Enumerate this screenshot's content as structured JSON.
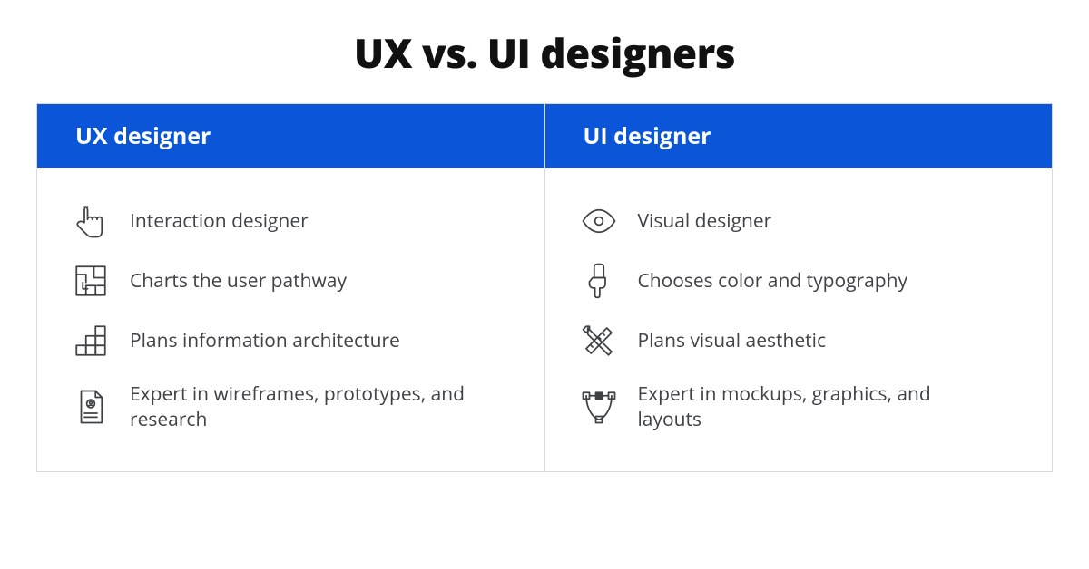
{
  "title": "UX vs. UI designers",
  "columns": {
    "left": {
      "header": "UX designer",
      "items": [
        {
          "label": "Interaction designer",
          "icon": "pointer-icon"
        },
        {
          "label": "Charts the user pathway",
          "icon": "maze-icon"
        },
        {
          "label": "Plans information architecture",
          "icon": "blocks-icon"
        },
        {
          "label": "Expert in wireframes, prototypes, and research",
          "icon": "document-icon"
        }
      ]
    },
    "right": {
      "header": "UI designer",
      "items": [
        {
          "label": "Visual designer",
          "icon": "eye-icon"
        },
        {
          "label": "Chooses color and typography",
          "icon": "paintbrush-icon"
        },
        {
          "label": "Plans visual aesthetic",
          "icon": "ruler-pencil-icon"
        },
        {
          "label": "Expert in mockups, graphics, and layouts",
          "icon": "vector-icon"
        }
      ]
    }
  },
  "colors": {
    "header_bg": "#0b56d8",
    "border": "#d7d9dc",
    "text": "#3f4246"
  }
}
